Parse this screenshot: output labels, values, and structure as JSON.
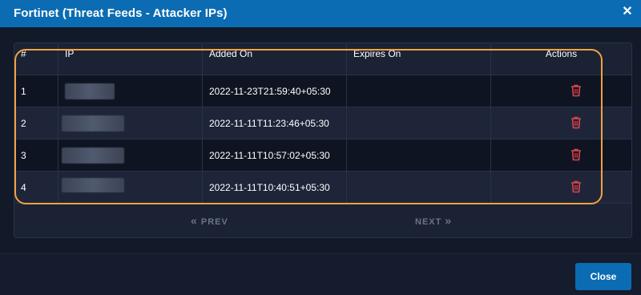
{
  "modal": {
    "title": "Fortinet (Threat Feeds - Attacker IPs)",
    "close_icon": "close-icon"
  },
  "table": {
    "columns": [
      "#",
      "IP",
      "Added On",
      "Expires On",
      "Actions"
    ],
    "rows": [
      {
        "num": "1",
        "ip": "",
        "added_on": "2022-11-23T21:59:40+05:30",
        "expires_on": ""
      },
      {
        "num": "2",
        "ip": "",
        "added_on": "2022-11-11T11:23:46+05:30",
        "expires_on": ""
      },
      {
        "num": "3",
        "ip": "",
        "added_on": "2022-11-11T10:57:02+05:30",
        "expires_on": ""
      },
      {
        "num": "4",
        "ip": "",
        "added_on": "2022-11-11T10:40:51+05:30",
        "expires_on": ""
      }
    ],
    "action_icon": "trash-icon",
    "colors": {
      "delete": "#e0424b",
      "highlight": "#f2a240"
    }
  },
  "pager": {
    "prev_label": "PREV",
    "next_label": "NEXT",
    "prev_icon": "double-chevron-left-icon",
    "next_icon": "double-chevron-right-icon"
  },
  "footer": {
    "close_label": "Close"
  },
  "colors": {
    "header": "#0b6cb3",
    "button": "#0b6cb3",
    "background": "#0f1523"
  }
}
